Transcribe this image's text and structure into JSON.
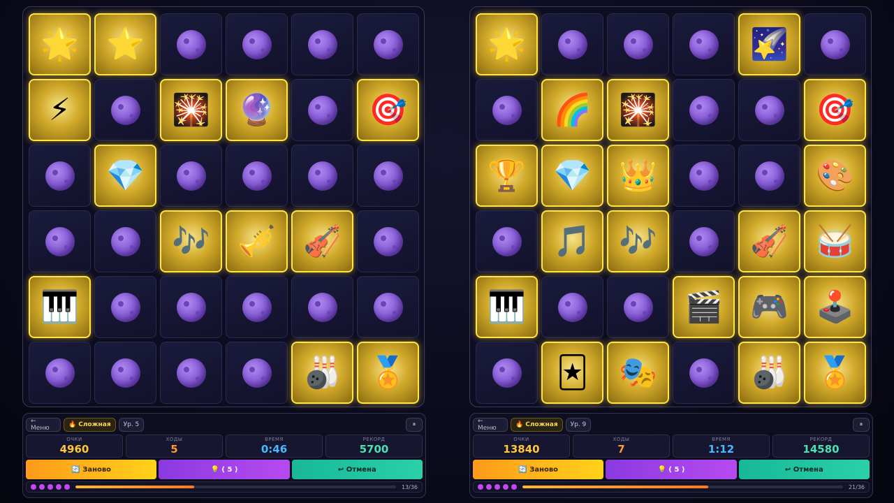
{
  "boards": [
    {
      "difficulty": "Сложная",
      "level": "Ур. 5",
      "menu_label": "← Меню",
      "pause_label": "⏸",
      "stats": [
        {
          "label": "ОЧКИ",
          "value": "4960"
        },
        {
          "label": "ХОДЫ",
          "value": "5"
        },
        {
          "label": "ВРЕМЯ",
          "value": "0:46"
        },
        {
          "label": "РЕКОРД",
          "value": "5700"
        }
      ],
      "buttons": {
        "restart": "🔄 Заново",
        "hint": "💡 ( 5 )",
        "undo": "↩ Отмена"
      },
      "progress": {
        "text": "13/36",
        "fraction": 0.37
      },
      "tiles": [
        "🌟",
        "⭐",
        "",
        "",
        "",
        "",
        "⚡",
        "",
        "🎇",
        "🔮",
        "",
        "🎯",
        "",
        "💎",
        "",
        "",
        "",
        "",
        "",
        "",
        "🎶",
        "🎺",
        "🎻",
        "",
        "🎹",
        "",
        "",
        "",
        "",
        "",
        "",
        "",
        "",
        "",
        "🎳",
        "🏅"
      ]
    },
    {
      "difficulty": "Сложная",
      "level": "Ур. 9",
      "menu_label": "← Меню",
      "pause_label": "⏸",
      "stats": [
        {
          "label": "ОЧКИ",
          "value": "13840"
        },
        {
          "label": "ХОДЫ",
          "value": "7"
        },
        {
          "label": "ВРЕМЯ",
          "value": "1:12"
        },
        {
          "label": "РЕКОРД",
          "value": "14580"
        }
      ],
      "buttons": {
        "restart": "🔄 Заново",
        "hint": "💡 ( 5 )",
        "undo": "↩ Отмена"
      },
      "progress": {
        "text": "21/36",
        "fraction": 0.58
      },
      "tiles": [
        "🌟",
        "",
        "",
        "",
        "🌠",
        "",
        "",
        "🌈",
        "🎇",
        "",
        "",
        "🎯",
        "🏆",
        "💎",
        "👑",
        "",
        "",
        "🎨",
        "",
        "🎵",
        "🎶",
        "",
        "🎻",
        "🥁",
        "🎹",
        "",
        "",
        "🎬",
        "🎮",
        "🕹️",
        "",
        "🃏",
        "🎭",
        "",
        "🎳",
        "🏅"
      ]
    }
  ]
}
